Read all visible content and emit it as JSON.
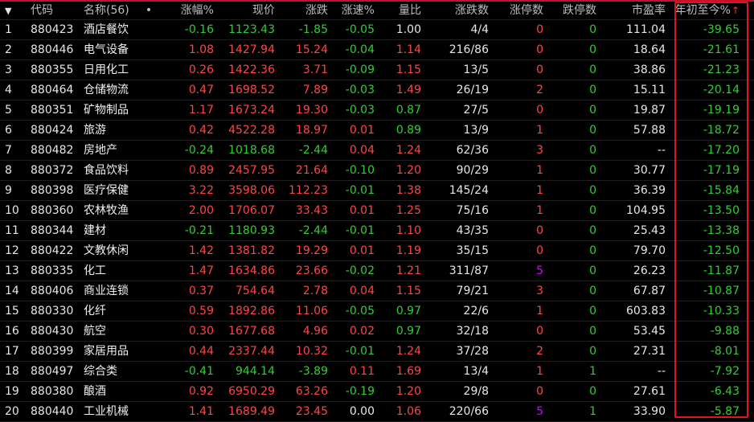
{
  "header": {
    "menu_icon": "caret-down-icon",
    "code": "代码",
    "name": "名称(56)",
    "dot": "•",
    "change_pct": "涨幅%",
    "price": "现价",
    "change": "涨跌",
    "speed": "涨速%",
    "volume_ratio": "量比",
    "up_down_count": "涨跌数",
    "limit_up": "涨停数",
    "limit_down": "跌停数",
    "pe": "市盈率",
    "ytd": "年初至今%",
    "sort_icon": "↑"
  },
  "colors": {
    "up": "#ff4545",
    "down": "#32cd32",
    "neutral": "#e6e6e6",
    "special": "#d200ff",
    "highlight": "#e2141b"
  },
  "rows": [
    {
      "idx": "1",
      "code": "880423",
      "name": "酒店餐饮",
      "zf": "-0.16",
      "xj": "1123.43",
      "zd": "-1.85",
      "zs": "-0.05",
      "lb": "1.00",
      "zds": "4/4",
      "ztg": "0",
      "dtg": "0",
      "syl": "111.04",
      "ytd": "-39.65"
    },
    {
      "idx": "2",
      "code": "880446",
      "name": "电气设备",
      "zf": "1.08",
      "xj": "1427.94",
      "zd": "15.24",
      "zs": "-0.04",
      "lb": "1.14",
      "zds": "216/86",
      "ztg": "0",
      "dtg": "0",
      "syl": "18.64",
      "ytd": "-21.61"
    },
    {
      "idx": "3",
      "code": "880355",
      "name": "日用化工",
      "zf": "0.26",
      "xj": "1422.36",
      "zd": "3.71",
      "zs": "-0.09",
      "lb": "1.15",
      "zds": "13/5",
      "ztg": "0",
      "dtg": "0",
      "syl": "38.86",
      "ytd": "-21.23"
    },
    {
      "idx": "4",
      "code": "880464",
      "name": "仓储物流",
      "zf": "0.47",
      "xj": "1698.52",
      "zd": "7.89",
      "zs": "-0.03",
      "lb": "1.49",
      "zds": "26/19",
      "ztg": "2",
      "dtg": "0",
      "syl": "15.11",
      "ytd": "-20.14"
    },
    {
      "idx": "5",
      "code": "880351",
      "name": "矿物制品",
      "zf": "1.17",
      "xj": "1673.24",
      "zd": "19.30",
      "zs": "-0.03",
      "lb": "0.87",
      "zds": "27/5",
      "ztg": "0",
      "dtg": "0",
      "syl": "19.87",
      "ytd": "-19.19"
    },
    {
      "idx": "6",
      "code": "880424",
      "name": "旅游",
      "zf": "0.42",
      "xj": "4522.28",
      "zd": "18.97",
      "zs": "0.01",
      "lb": "0.89",
      "zds": "13/9",
      "ztg": "1",
      "dtg": "0",
      "syl": "57.88",
      "ytd": "-18.72"
    },
    {
      "idx": "7",
      "code": "880482",
      "name": "房地产",
      "zf": "-0.24",
      "xj": "1018.68",
      "zd": "-2.44",
      "zs": "0.04",
      "lb": "1.24",
      "zds": "62/36",
      "ztg": "3",
      "dtg": "0",
      "syl": "--",
      "ytd": "-17.20"
    },
    {
      "idx": "8",
      "code": "880372",
      "name": "食品饮料",
      "zf": "0.89",
      "xj": "2457.95",
      "zd": "21.64",
      "zs": "-0.10",
      "lb": "1.20",
      "zds": "90/29",
      "ztg": "1",
      "dtg": "0",
      "syl": "30.77",
      "ytd": "-17.19"
    },
    {
      "idx": "9",
      "code": "880398",
      "name": "医疗保健",
      "zf": "3.22",
      "xj": "3598.06",
      "zd": "112.23",
      "zs": "-0.01",
      "lb": "1.38",
      "zds": "145/24",
      "ztg": "1",
      "dtg": "0",
      "syl": "36.39",
      "ytd": "-15.84"
    },
    {
      "idx": "10",
      "code": "880360",
      "name": "农林牧渔",
      "zf": "2.00",
      "xj": "1706.07",
      "zd": "33.43",
      "zs": "0.01",
      "lb": "1.25",
      "zds": "75/16",
      "ztg": "1",
      "dtg": "0",
      "syl": "104.95",
      "ytd": "-13.50"
    },
    {
      "idx": "11",
      "code": "880344",
      "name": "建材",
      "zf": "-0.21",
      "xj": "1180.93",
      "zd": "-2.44",
      "zs": "-0.01",
      "lb": "1.10",
      "zds": "43/35",
      "ztg": "0",
      "dtg": "0",
      "syl": "25.43",
      "ytd": "-13.38"
    },
    {
      "idx": "12",
      "code": "880422",
      "name": "文教休闲",
      "zf": "1.42",
      "xj": "1381.82",
      "zd": "19.29",
      "zs": "0.01",
      "lb": "1.19",
      "zds": "35/15",
      "ztg": "0",
      "dtg": "0",
      "syl": "79.70",
      "ytd": "-12.50"
    },
    {
      "idx": "13",
      "code": "880335",
      "name": "化工",
      "zf": "1.47",
      "xj": "1634.86",
      "zd": "23.66",
      "zs": "-0.02",
      "lb": "1.21",
      "zds": "311/87",
      "ztg": "5",
      "dtg": "0",
      "syl": "26.23",
      "ytd": "-11.87"
    },
    {
      "idx": "14",
      "code": "880406",
      "name": "商业连锁",
      "zf": "0.37",
      "xj": "754.64",
      "zd": "2.78",
      "zs": "0.04",
      "lb": "1.15",
      "zds": "79/21",
      "ztg": "3",
      "dtg": "0",
      "syl": "67.87",
      "ytd": "-10.87"
    },
    {
      "idx": "15",
      "code": "880330",
      "name": "化纤",
      "zf": "0.59",
      "xj": "1892.86",
      "zd": "11.06",
      "zs": "-0.05",
      "lb": "0.97",
      "zds": "22/6",
      "ztg": "1",
      "dtg": "0",
      "syl": "603.83",
      "ytd": "-10.33"
    },
    {
      "idx": "16",
      "code": "880430",
      "name": "航空",
      "zf": "0.30",
      "xj": "1677.68",
      "zd": "4.96",
      "zs": "0.02",
      "lb": "0.97",
      "zds": "32/18",
      "ztg": "0",
      "dtg": "0",
      "syl": "53.45",
      "ytd": "-9.88"
    },
    {
      "idx": "17",
      "code": "880399",
      "name": "家居用品",
      "zf": "0.44",
      "xj": "2337.44",
      "zd": "10.32",
      "zs": "-0.01",
      "lb": "1.24",
      "zds": "37/28",
      "ztg": "2",
      "dtg": "0",
      "syl": "27.31",
      "ytd": "-8.01"
    },
    {
      "idx": "18",
      "code": "880497",
      "name": "综合类",
      "zf": "-0.41",
      "xj": "944.14",
      "zd": "-3.89",
      "zs": "0.11",
      "lb": "1.69",
      "zds": "13/4",
      "ztg": "1",
      "dtg": "1",
      "syl": "--",
      "ytd": "-7.92"
    },
    {
      "idx": "19",
      "code": "880380",
      "name": "酿酒",
      "zf": "0.92",
      "xj": "6950.29",
      "zd": "63.26",
      "zs": "-0.19",
      "lb": "1.20",
      "zds": "29/8",
      "ztg": "0",
      "dtg": "0",
      "syl": "27.61",
      "ytd": "-6.43"
    },
    {
      "idx": "20",
      "code": "880440",
      "name": "工业机械",
      "zf": "1.41",
      "xj": "1689.49",
      "zd": "23.45",
      "zs": "0.00",
      "lb": "1.06",
      "zds": "220/66",
      "ztg": "5",
      "dtg": "1",
      "syl": "33.90",
      "ytd": "-5.87"
    }
  ]
}
